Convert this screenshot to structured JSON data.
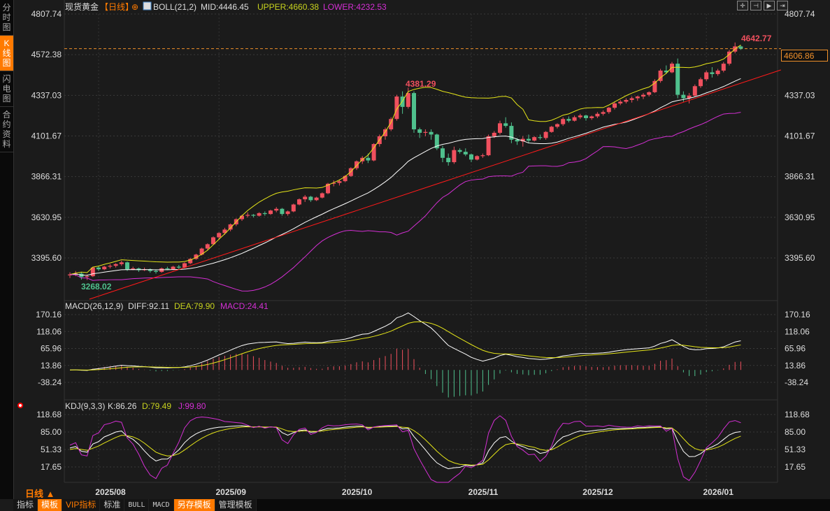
{
  "sidebar": {
    "tabs": [
      {
        "label": "分时图",
        "active": false
      },
      {
        "label": "K线图",
        "active": true
      },
      {
        "label": "闪电图",
        "active": false
      },
      {
        "label": "合约资料",
        "active": false
      }
    ]
  },
  "header": {
    "symbol": "现货黄金",
    "period_tag": "【日线】",
    "boll": "BOLL(21,2)",
    "mid": "MID:4446.45",
    "upper": "UPPER:4660.38",
    "lower": "LOWER:4232.53"
  },
  "macd_legend": {
    "name": "MACD(26,12,9)",
    "diff": "DIFF:92.11",
    "dea": "DEA:79.90",
    "macd": "MACD:24.41"
  },
  "kdj_legend": {
    "name": "KDJ(9,3,3)",
    "k": "K:86.26",
    "d": "D:79.49",
    "j": "J:99.80"
  },
  "colors": {
    "up": "#f0505e",
    "down": "#4fc08d",
    "mid": "#ffffff",
    "upper": "#e6e619",
    "lower": "#d42fd4",
    "trend": "#ff1a1a",
    "accent": "#ff7a00"
  },
  "price_axis": {
    "ticks": [
      "4807.74",
      "4572.38",
      "4337.03",
      "4101.67",
      "3866.31",
      "3630.95",
      "3395.60"
    ],
    "last_price": "4606.86"
  },
  "macd_axis": {
    "ticks": [
      "170.16",
      "118.06",
      "65.96",
      "13.86",
      "-38.24"
    ]
  },
  "kdj_axis": {
    "ticks": [
      "118.68",
      "85.00",
      "51.33",
      "17.65"
    ]
  },
  "annotations": {
    "high": "4642.77",
    "mid_high": "4381.29",
    "low": "3268.02"
  },
  "period_label": "日线 ▲",
  "date_axis": [
    "2025/08",
    "2025/09",
    "2025/10",
    "2025/11",
    "2025/12",
    "2026/01"
  ],
  "toolbar": [
    "指标",
    "模板",
    "VIP指标",
    "标准",
    "BULL",
    "MACD",
    "另存模板",
    "管理模板"
  ],
  "tools": [
    "crosshair",
    "zoom-start",
    "play",
    "end"
  ],
  "chart_data": {
    "type": "candlestick",
    "ylim": [
      3160,
      4807.74
    ],
    "trendline": [
      [
        3.4,
        3157
      ],
      [
        124,
        4484
      ]
    ],
    "month_start_index": [
      5,
      26,
      48,
      70,
      90,
      111
    ],
    "ohlc": [
      [
        3295,
        3312,
        3280,
        3300
      ],
      [
        3300,
        3320,
        3290,
        3305
      ],
      [
        3305,
        3315,
        3270,
        3285
      ],
      [
        3285,
        3300,
        3268.02,
        3290
      ],
      [
        3290,
        3345,
        3285,
        3340
      ],
      [
        3340,
        3350,
        3320,
        3330
      ],
      [
        3330,
        3350,
        3325,
        3345
      ],
      [
        3345,
        3360,
        3335,
        3350
      ],
      [
        3350,
        3365,
        3340,
        3360
      ],
      [
        3360,
        3380,
        3350,
        3370
      ],
      [
        3370,
        3375,
        3320,
        3330
      ],
      [
        3330,
        3345,
        3325,
        3335
      ],
      [
        3335,
        3340,
        3315,
        3325
      ],
      [
        3325,
        3340,
        3320,
        3330
      ],
      [
        3330,
        3335,
        3310,
        3320
      ],
      [
        3320,
        3330,
        3305,
        3315
      ],
      [
        3315,
        3340,
        3310,
        3335
      ],
      [
        3335,
        3345,
        3325,
        3330
      ],
      [
        3330,
        3350,
        3325,
        3345
      ],
      [
        3345,
        3355,
        3330,
        3340
      ],
      [
        3340,
        3370,
        3335,
        3365
      ],
      [
        3365,
        3395,
        3360,
        3390
      ],
      [
        3390,
        3420,
        3385,
        3415
      ],
      [
        3415,
        3455,
        3410,
        3450
      ],
      [
        3450,
        3480,
        3440,
        3475
      ],
      [
        3475,
        3520,
        3470,
        3515
      ],
      [
        3515,
        3545,
        3500,
        3540
      ],
      [
        3540,
        3570,
        3530,
        3560
      ],
      [
        3560,
        3595,
        3550,
        3590
      ],
      [
        3590,
        3625,
        3580,
        3620
      ],
      [
        3620,
        3645,
        3610,
        3640
      ],
      [
        3640,
        3660,
        3630,
        3645
      ],
      [
        3645,
        3650,
        3630,
        3640
      ],
      [
        3640,
        3660,
        3635,
        3655
      ],
      [
        3655,
        3665,
        3640,
        3650
      ],
      [
        3650,
        3675,
        3645,
        3670
      ],
      [
        3670,
        3690,
        3660,
        3680
      ],
      [
        3680,
        3685,
        3640,
        3650
      ],
      [
        3650,
        3670,
        3640,
        3665
      ],
      [
        3665,
        3710,
        3660,
        3705
      ],
      [
        3705,
        3740,
        3700,
        3735
      ],
      [
        3735,
        3760,
        3720,
        3750
      ],
      [
        3750,
        3755,
        3720,
        3730
      ],
      [
        3730,
        3750,
        3725,
        3745
      ],
      [
        3745,
        3775,
        3740,
        3770
      ],
      [
        3770,
        3830,
        3765,
        3825
      ],
      [
        3825,
        3845,
        3810,
        3830
      ],
      [
        3830,
        3850,
        3815,
        3840
      ],
      [
        3840,
        3875,
        3835,
        3870
      ],
      [
        3870,
        3920,
        3865,
        3915
      ],
      [
        3915,
        3960,
        3905,
        3955
      ],
      [
        3955,
        3985,
        3940,
        3975
      ],
      [
        3975,
        4000,
        3945,
        3960
      ],
      [
        3960,
        4060,
        3955,
        4055
      ],
      [
        4055,
        4110,
        4040,
        4100
      ],
      [
        4100,
        4150,
        4080,
        4140
      ],
      [
        4140,
        4210,
        4130,
        4200
      ],
      [
        4200,
        4340,
        4190,
        4330
      ],
      [
        4330,
        4360,
        4230,
        4270
      ],
      [
        4270,
        4381.29,
        4260,
        4350
      ],
      [
        4350,
        4360,
        4120,
        4140
      ],
      [
        4140,
        4150,
        4090,
        4120
      ],
      [
        4120,
        4140,
        4100,
        4125
      ],
      [
        4125,
        4140,
        4080,
        4110
      ],
      [
        4110,
        4115,
        4020,
        4030
      ],
      [
        4030,
        4045,
        3950,
        3975
      ],
      [
        3975,
        4000,
        3930,
        3950
      ],
      [
        3950,
        4040,
        3940,
        4020
      ],
      [
        4020,
        4030,
        4000,
        4010
      ],
      [
        4010,
        4030,
        3985,
        3995
      ],
      [
        3995,
        4000,
        3950,
        3965
      ],
      [
        3965,
        3990,
        3960,
        3985
      ],
      [
        3985,
        4000,
        3975,
        3990
      ],
      [
        3990,
        4110,
        3985,
        4100
      ],
      [
        4100,
        4130,
        4090,
        4120
      ],
      [
        4120,
        4190,
        4110,
        4175
      ],
      [
        4175,
        4210,
        4150,
        4160
      ],
      [
        4160,
        4180,
        4060,
        4080
      ],
      [
        4080,
        4090,
        4050,
        4070
      ],
      [
        4070,
        4100,
        4040,
        4085
      ],
      [
        4085,
        4110,
        4060,
        4075
      ],
      [
        4075,
        4100,
        4070,
        4095
      ],
      [
        4095,
        4110,
        4080,
        4090
      ],
      [
        4090,
        4130,
        4080,
        4125
      ],
      [
        4125,
        4160,
        4120,
        4155
      ],
      [
        4155,
        4175,
        4145,
        4170
      ],
      [
        4170,
        4210,
        4160,
        4200
      ],
      [
        4200,
        4215,
        4180,
        4190
      ],
      [
        4190,
        4220,
        4185,
        4210
      ],
      [
        4210,
        4230,
        4200,
        4220
      ],
      [
        4220,
        4225,
        4190,
        4205
      ],
      [
        4205,
        4220,
        4195,
        4215
      ],
      [
        4215,
        4240,
        4205,
        4230
      ],
      [
        4230,
        4250,
        4220,
        4240
      ],
      [
        4240,
        4270,
        4230,
        4265
      ],
      [
        4265,
        4300,
        4255,
        4290
      ],
      [
        4290,
        4310,
        4280,
        4300
      ],
      [
        4300,
        4320,
        4290,
        4310
      ],
      [
        4310,
        4330,
        4295,
        4320
      ],
      [
        4320,
        4335,
        4305,
        4330
      ],
      [
        4330,
        4350,
        4315,
        4340
      ],
      [
        4340,
        4360,
        4330,
        4355
      ],
      [
        4355,
        4430,
        4350,
        4420
      ],
      [
        4420,
        4490,
        4410,
        4480
      ],
      [
        4480,
        4510,
        4460,
        4470
      ],
      [
        4470,
        4530,
        4465,
        4520
      ],
      [
        4520,
        4550,
        4320,
        4340
      ],
      [
        4340,
        4360,
        4300,
        4320
      ],
      [
        4320,
        4350,
        4290,
        4335
      ],
      [
        4335,
        4400,
        4330,
        4390
      ],
      [
        4390,
        4440,
        4380,
        4430
      ],
      [
        4430,
        4480,
        4420,
        4470
      ],
      [
        4470,
        4500,
        4440,
        4460
      ],
      [
        4460,
        4490,
        4450,
        4480
      ],
      [
        4480,
        4530,
        4470,
        4520
      ],
      [
        4520,
        4600,
        4510,
        4590
      ],
      [
        4590,
        4642.77,
        4580,
        4620
      ],
      [
        4620,
        4625,
        4600,
        4606.86
      ]
    ]
  }
}
